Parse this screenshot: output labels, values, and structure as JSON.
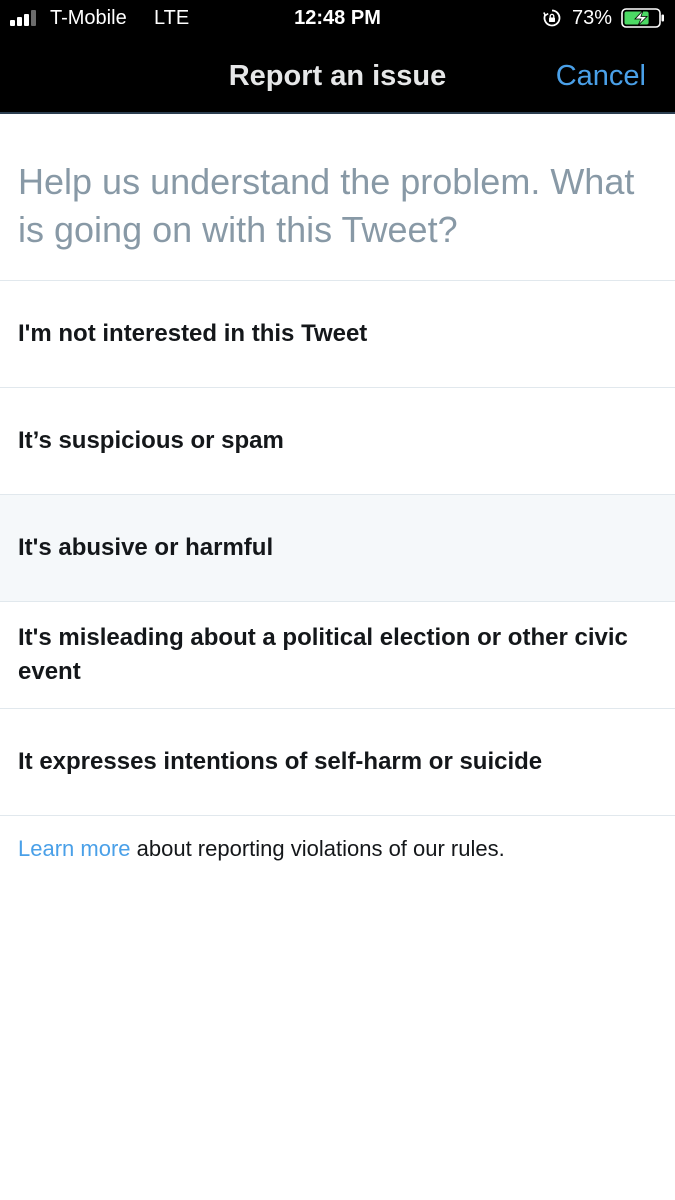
{
  "status_bar": {
    "carrier": "T-Mobile",
    "network": "LTE",
    "time": "12:48 PM",
    "battery_percent": "73%",
    "signal_bars_active": 3,
    "signal_bars_total": 4,
    "battery_level": 0.73,
    "charging": true,
    "icons": [
      "signal-icon",
      "rotation-lock-icon",
      "battery-charging-icon"
    ]
  },
  "nav": {
    "title": "Report an issue",
    "cancel_label": "Cancel"
  },
  "prompt": "Help us understand the problem. What is going on with this Tweet?",
  "options": [
    {
      "label": "I'm not interested in this Tweet",
      "highlighted": false
    },
    {
      "label": "It’s suspicious or spam",
      "highlighted": false
    },
    {
      "label": "It's abusive or harmful",
      "highlighted": true
    },
    {
      "label": "It's misleading about a political election or other civic event",
      "highlighted": false
    },
    {
      "label": "It expresses intentions of self-harm or suicide",
      "highlighted": false
    }
  ],
  "footer": {
    "link_text": "Learn more",
    "text": " about reporting violations of our rules."
  },
  "colors": {
    "accent": "#4aa0e8",
    "prompt_text": "#8899a6",
    "nav_background": "#000000",
    "highlight_background": "#f5f8fa",
    "charging_green": "#4cd964"
  }
}
